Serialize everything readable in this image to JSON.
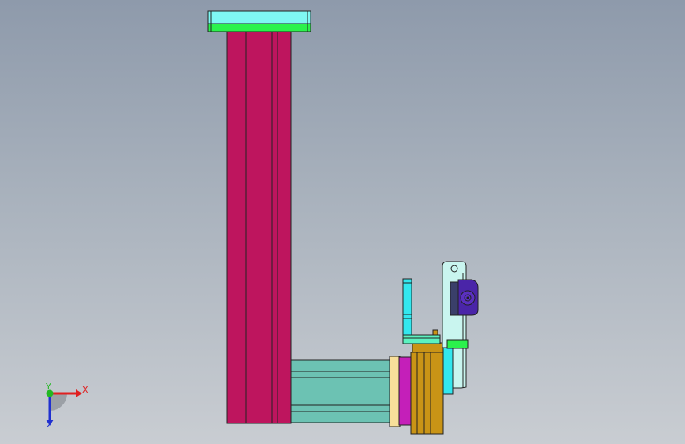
{
  "viewport": {
    "background_top": "#8e9aab",
    "background_bottom": "#c9cdd2"
  },
  "model": {
    "column_color": "#be155e",
    "top_plate_color": "#7ff7f4",
    "top_band_color": "#2bf24c",
    "carriage_color": "#6cc2b3",
    "flange_color": "#f7df9a",
    "motor_color": "#c41fb9",
    "bracket_color": "#c99416",
    "cyan_part_color": "#33e7ee",
    "clamp_color": "#4a25a8",
    "plate_color": "#c9f5ef"
  },
  "triad": {
    "x_label": "X",
    "y_label": "Y",
    "z_label": "Z",
    "x_color": "#e02020",
    "y_color": "#22b822",
    "z_color": "#2030d0"
  }
}
